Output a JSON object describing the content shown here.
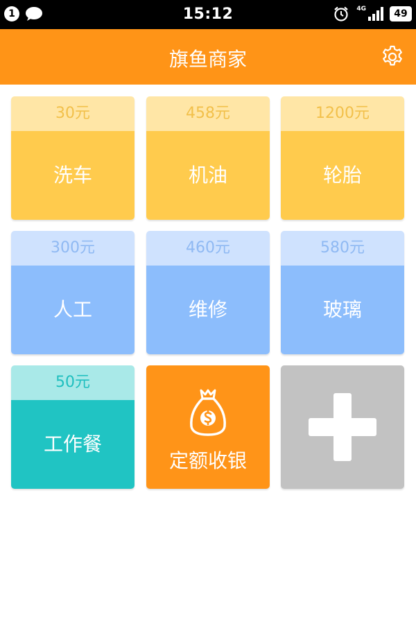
{
  "status_bar": {
    "notification_count": "1",
    "time": "15:12",
    "network": "4G",
    "battery": "49"
  },
  "header": {
    "title": "旗鱼商家",
    "settings_icon": "gear-icon"
  },
  "items": [
    {
      "price": "30元",
      "name": "洗车"
    },
    {
      "price": "458元",
      "name": "机油"
    },
    {
      "price": "1200元",
      "name": "轮胎"
    },
    {
      "price": "300元",
      "name": "人工"
    },
    {
      "price": "460元",
      "name": "维修"
    },
    {
      "price": "580元",
      "name": "玻璃"
    },
    {
      "price": "50元",
      "name": "工作餐"
    }
  ],
  "fixed_amount": {
    "label": "定额收银",
    "icon": "money-bag-icon"
  },
  "add_tile": {
    "icon": "plus-icon"
  },
  "colors": {
    "header": "#ff9417",
    "yellow_tile": "#ffcb4d",
    "blue_tile": "#8cbdfc",
    "teal_tile": "#20c4c3",
    "orange_tile": "#ff9418",
    "gray_tile": "#c2c2c2"
  }
}
